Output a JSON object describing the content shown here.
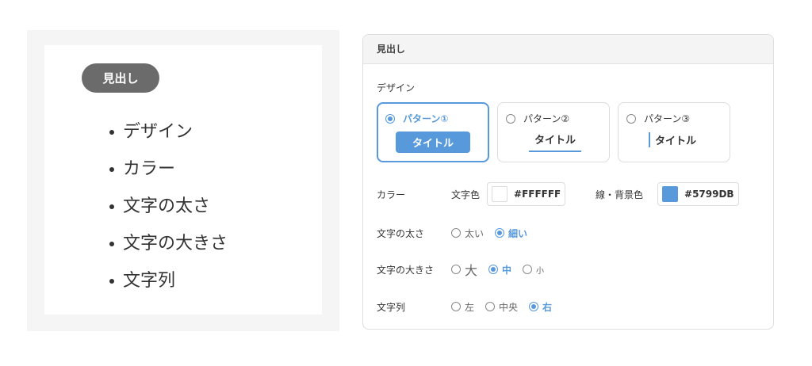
{
  "preview": {
    "pill_label": "見出し",
    "items": [
      "デザイン",
      "カラー",
      "文字の太さ",
      "文字の大きさ",
      "文字列"
    ]
  },
  "panel": {
    "header": "見出し",
    "design_label": "デザイン",
    "patterns": [
      {
        "label": "パターン①",
        "sample": "タイトル",
        "selected": true
      },
      {
        "label": "パターン②",
        "sample": "タイトル",
        "selected": false
      },
      {
        "label": "パターン③",
        "sample": "タイトル",
        "selected": false
      }
    ],
    "color": {
      "label": "カラー",
      "text_color_label": "文字色",
      "text_color_value": "#FFFFFF",
      "line_bg_label": "線・背景色",
      "line_bg_value": "#5799DB"
    },
    "weight": {
      "label": "文字の太さ",
      "options": [
        "太い",
        "細い"
      ],
      "selected": "細い"
    },
    "size": {
      "label": "文字の大きさ",
      "options": [
        "大",
        "中",
        "小"
      ],
      "selected": "中"
    },
    "align": {
      "label": "文字列",
      "options": [
        "左",
        "中央",
        "右"
      ],
      "selected": "右"
    }
  },
  "colors": {
    "accent": "#5799DB",
    "pill": "#6b6b6b"
  }
}
